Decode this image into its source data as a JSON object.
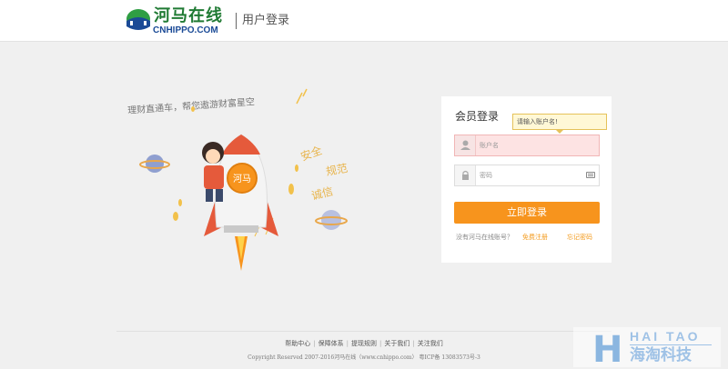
{
  "header": {
    "logo_cn": "河马在线",
    "logo_en": "CNHIPPO.COM",
    "section_title": "用户登录"
  },
  "illustration": {
    "slogan": "理财直通车，帮您遨游财富星空",
    "tags": [
      "安全",
      "规范",
      "诚信"
    ],
    "badge_text": "河马"
  },
  "login": {
    "title": "会员登录",
    "tooltip": "请输入账户名!",
    "username_placeholder": "账户名",
    "password_placeholder": "密码",
    "submit_label": "立即登录",
    "no_account_text": "没有河马在线账号？",
    "register_link": "免费注册",
    "forgot_link": "忘记密码"
  },
  "footer": {
    "links": [
      "帮助中心",
      "保障体系",
      "提现规则",
      "关于我们",
      "关注我们"
    ],
    "copyright": "Copyright Reserved 2007-2016河马在线（www.cnhippo.com） 粤ICP备 13083573号-3"
  },
  "watermark": {
    "letter": "H",
    "en": "HAI TAO",
    "cn": "海淘科技"
  },
  "colors": {
    "accent": "#f7941d",
    "brand_green": "#1f7a33",
    "brand_blue": "#1a4a96",
    "link": "#f39b1e",
    "error_bg": "#fde3e3"
  }
}
